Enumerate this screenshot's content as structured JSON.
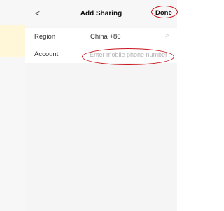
{
  "header": {
    "back_icon": "chevron-left-icon",
    "back_glyph": "<",
    "title": "Add Sharing",
    "done_label": "Done"
  },
  "form": {
    "region": {
      "label": "Region",
      "value": "China +86",
      "chevron_glyph": ">"
    },
    "account": {
      "label": "Account",
      "value": "",
      "placeholder": "Enter mobile phone number"
    }
  },
  "colors": {
    "annotation_ring": "#c9161d",
    "left_highlight": "#fff7d8",
    "page_background": "#f5f5f5"
  }
}
